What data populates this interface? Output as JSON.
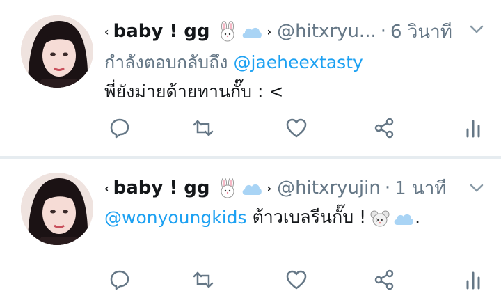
{
  "tweets": [
    {
      "display_name": "baby ! gg",
      "name_prefix": "‹",
      "name_suffix": "›",
      "handle": "@hitxryu...",
      "separator": "·",
      "time": "6 วินาที",
      "reply_prefix": "กำลังตอบกลับถึง",
      "reply_mention": "@jaeheextasty",
      "text": "พี่ยังม่ายด้ายทานกั๊บ : <"
    },
    {
      "display_name": "baby ! gg",
      "name_prefix": "‹",
      "name_suffix": "›",
      "handle": "@hitxryujin",
      "separator": "·",
      "time": "1 นาที",
      "mention": "@wonyoungkids",
      "text": "ต้าวเบลรีนกั๊บ ! ",
      "text_end": "."
    }
  ],
  "colors": {
    "accent": "#1da1f2",
    "muted": "#657786",
    "text": "#14171a",
    "divider": "#e6ecf0"
  },
  "icons": [
    "avatar",
    "bunny-emoji",
    "cloud-emoji",
    "mouse-emoji",
    "chevron-down-icon",
    "reply-icon",
    "retweet-icon",
    "like-icon",
    "share-icon",
    "analytics-icon"
  ]
}
